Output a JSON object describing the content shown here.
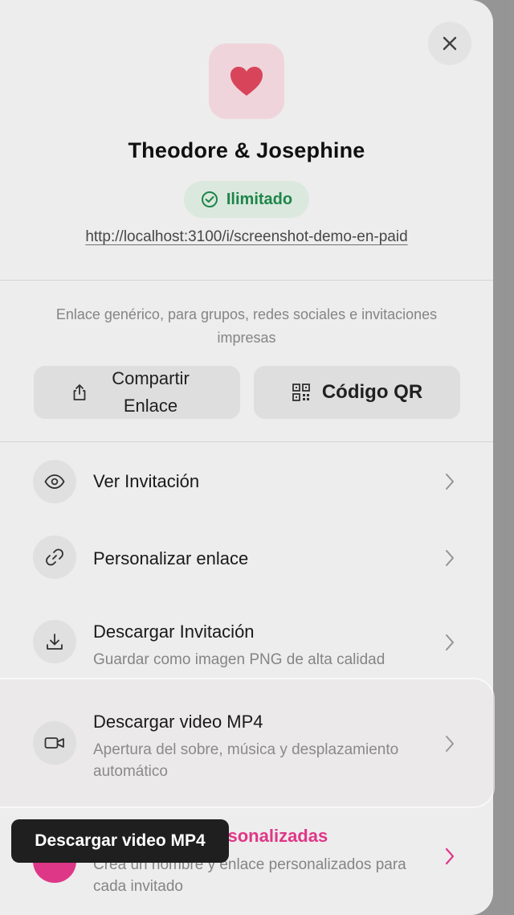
{
  "header": {
    "title": "Theodore & Josephine",
    "badge": "Ilimitado",
    "link": "http://localhost:3100/i/screenshot-demo-en-paid"
  },
  "share": {
    "description": "Enlace genérico, para grupos, redes sociales e invitaciones impresas",
    "share_button": "Compartir Enlace",
    "qr_button": "Código QR"
  },
  "rows": [
    {
      "title": "Ver Invitación",
      "subtitle": ""
    },
    {
      "title": "Personalizar enlace",
      "subtitle": ""
    },
    {
      "title": "Descargar Invitación",
      "subtitle": "Guardar como imagen PNG de alta calidad"
    },
    {
      "title": "Descargar video MP4",
      "subtitle": "Apertura del sobre, música y desplazamiento automático"
    },
    {
      "title": "Invitaciones personalizadas",
      "subtitle": "Crea un nombre y enlace personalizados para cada invitado"
    }
  ],
  "tooltip": "Descargar video MP4",
  "colors": {
    "accent_pink": "#e83a8c",
    "heart": "#e0485f",
    "badge_green": "#1f8a4c"
  },
  "icons": {
    "close": "close-icon",
    "heart": "heart-icon",
    "check": "check-circle-icon",
    "share": "share-icon",
    "qr": "qr-code-icon",
    "eye": "eye-icon",
    "link": "link-icon",
    "download": "download-icon",
    "video": "video-camera-icon",
    "chevron": "chevron-right-icon"
  }
}
